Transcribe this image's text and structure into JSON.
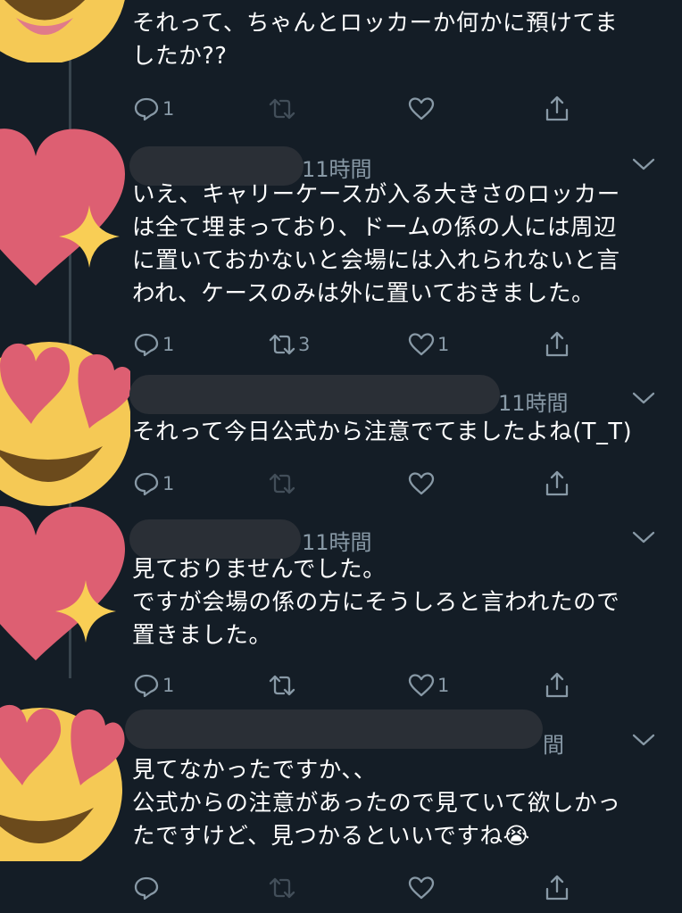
{
  "colors": {
    "background": "#141d26",
    "text": "#ffffff",
    "secondary": "#8899a6",
    "thread_line": "#38444d",
    "heart_pink": "#dd5f72",
    "sparkle_yellow": "#f9ce55",
    "face_yellow": "#f5c955"
  },
  "tweets": [
    {
      "time": "",
      "body": "それって、ちゃんとロッカーか何かに預けてま\nしたか??",
      "reply_count": "1",
      "retweet_count": "",
      "like_count": "",
      "avatar": "heart-eyes-face"
    },
    {
      "time": "11時間",
      "body": "いえ、キャリーケースが入る大きさのロッカー\nは全て埋まっており、ドームの係の人には周辺\nに置いておかないと会場には入れられないと言\nわれ、ケースのみは外に置いておきました。",
      "reply_count": "1",
      "retweet_count": "3",
      "like_count": "1",
      "avatar": "sparkling-heart"
    },
    {
      "time": "11時間",
      "body": "それって今日公式から注意でてましたよね(T_T)",
      "reply_count": "1",
      "retweet_count": "",
      "like_count": "",
      "avatar": "heart-eyes-face"
    },
    {
      "time": "11時間",
      "body": "見ておりませんでした。\nですが会場の係の方にそうしろと言われたので\n置きました。",
      "reply_count": "1",
      "retweet_count": "",
      "like_count": "1",
      "avatar": "sparkling-heart"
    },
    {
      "time": "間",
      "body": "見てなかったですか、、\n公式からの注意があったので見ていて欲しかっ\nたですけど、見つかるといいですね😭",
      "reply_count": "",
      "retweet_count": "",
      "like_count": "",
      "avatar": "heart-eyes-face"
    }
  ]
}
